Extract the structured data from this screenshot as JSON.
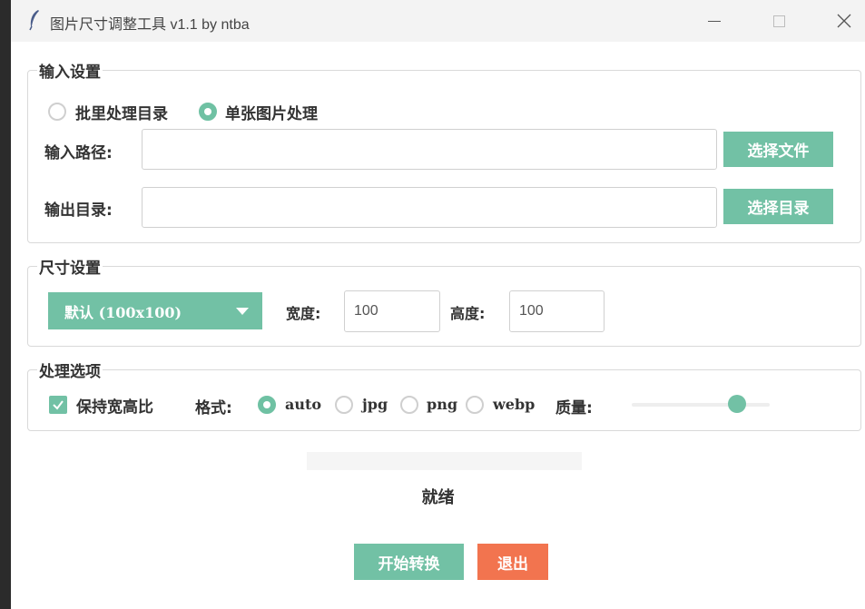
{
  "window": {
    "title": "图片尺寸调整工具 v1.1 by ntba",
    "icon": "feather-icon"
  },
  "input_settings": {
    "legend": "输入设置",
    "mode_options": [
      {
        "label": "批里处理目录",
        "selected": false
      },
      {
        "label": "单张图片处理",
        "selected": true
      }
    ],
    "input_path_label": "输入路径:",
    "input_path_value": "",
    "select_file_button": "选择文件",
    "output_dir_label": "输出目录:",
    "output_dir_value": "",
    "select_dir_button": "选择目录"
  },
  "size_settings": {
    "legend": "尺寸设置",
    "preset_selected": "默认 (100x100)",
    "width_label": "宽度:",
    "width_value": "100",
    "height_label": "高度:",
    "height_value": "100"
  },
  "processing_options": {
    "legend": "处理选项",
    "keep_ratio_label": "保持宽高比",
    "keep_ratio_checked": true,
    "format_label": "格式:",
    "formats": [
      {
        "label": "auto",
        "selected": true
      },
      {
        "label": "jpg",
        "selected": false
      },
      {
        "label": "png",
        "selected": false
      },
      {
        "label": "webp",
        "selected": false
      }
    ],
    "quality_label": "质量:",
    "quality_fraction": 0.76
  },
  "progress": {
    "fraction": 0
  },
  "status_text": "就绪",
  "actions": {
    "start_button": "开始转换",
    "exit_button": "退出"
  },
  "colors": {
    "accent_green": "#72c1a5",
    "exit_orange": "#f2744f"
  }
}
